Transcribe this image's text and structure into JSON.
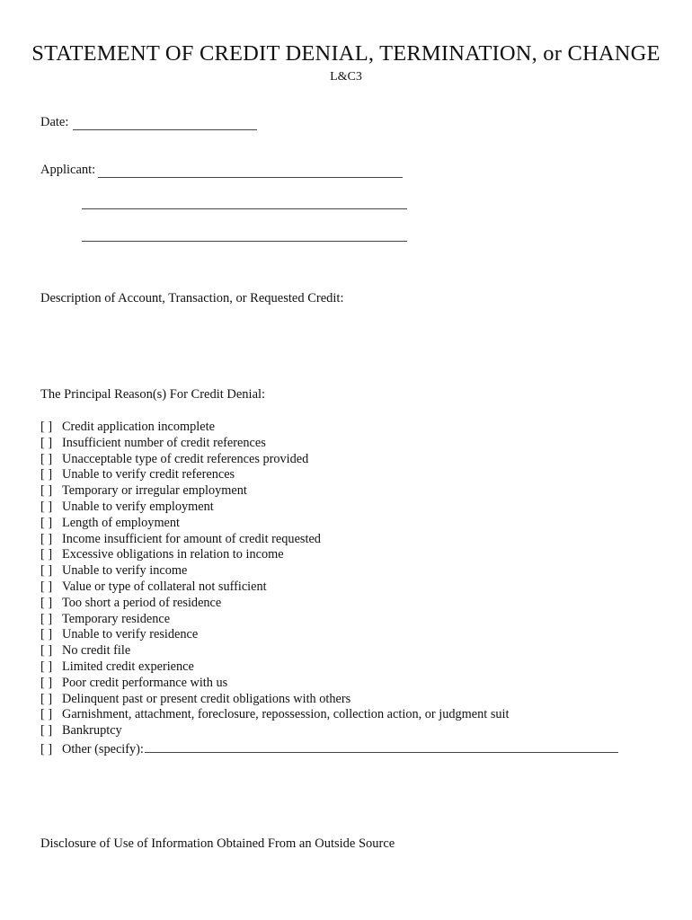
{
  "document": {
    "title": "STATEMENT OF CREDIT DENIAL, TERMINATION, or CHANGE",
    "form_code": "L&C3"
  },
  "fields": {
    "date_label": "Date:",
    "date_value": "",
    "applicant_label": "Applicant:",
    "applicant_value": "",
    "applicant_line2_value": "",
    "applicant_line3_value": "",
    "description_label": "Description of Account, Transaction, or Requested Credit:"
  },
  "reasons": {
    "heading": "The Principal Reason(s) For Credit Denial:",
    "checkbox_glyph": "[   ]",
    "items": [
      {
        "label": "Credit application incomplete",
        "checked": false
      },
      {
        "label": "Insufficient number of credit references",
        "checked": false
      },
      {
        "label": "Unacceptable type of credit references provided",
        "checked": false
      },
      {
        "label": "Unable to verify credit references",
        "checked": false
      },
      {
        "label": "Temporary or irregular employment",
        "checked": false
      },
      {
        "label": "Unable to verify employment",
        "checked": false
      },
      {
        "label": "Length of employment",
        "checked": false
      },
      {
        "label": "Income insufficient for amount of credit requested",
        "checked": false
      },
      {
        "label": "Excessive obligations in relation to income",
        "checked": false
      },
      {
        "label": "Unable to verify income",
        "checked": false
      },
      {
        "label": "Value or type of collateral not sufficient",
        "checked": false
      },
      {
        "label": "Too short a period of residence",
        "checked": false
      },
      {
        "label": "Temporary residence",
        "checked": false
      },
      {
        "label": "Unable to verify residence",
        "checked": false
      },
      {
        "label": "No credit file",
        "checked": false
      },
      {
        "label": "Limited credit experience",
        "checked": false
      },
      {
        "label": "Poor credit performance with us",
        "checked": false
      },
      {
        "label": "Delinquent past or present credit obligations with others",
        "checked": false
      },
      {
        "label": "Garnishment, attachment, foreclosure, repossession, collection action, or judgment suit",
        "checked": false
      },
      {
        "label": "Bankruptcy",
        "checked": false
      }
    ],
    "other": {
      "label": "Other (specify):",
      "value": "",
      "checked": false
    }
  },
  "disclosure": {
    "heading": "Disclosure of Use of Information Obtained From an Outside Source"
  }
}
